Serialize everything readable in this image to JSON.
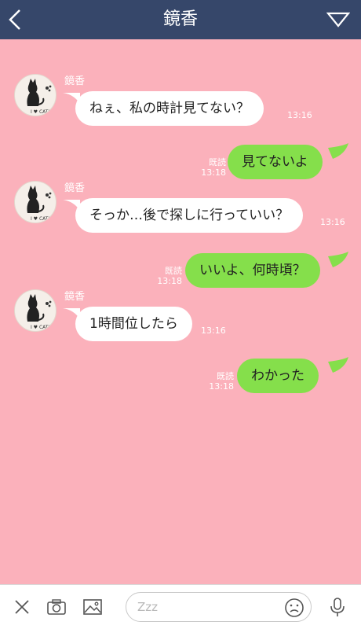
{
  "header": {
    "title": "鏡香"
  },
  "messages": [
    {
      "direction": "in",
      "sender": "鏡香",
      "text": "ねぇ、私の時計見てない？",
      "time": "13:16"
    },
    {
      "direction": "out",
      "text": "見てないよ",
      "read": "既読",
      "time": "13:18"
    },
    {
      "direction": "in",
      "sender": "鏡香",
      "text": "そっか…後で探しに行っていい？",
      "time": "13:16"
    },
    {
      "direction": "out",
      "text": "いいよ、何時頃？",
      "read": "既読",
      "time": "13:18"
    },
    {
      "direction": "in",
      "sender": "鏡香",
      "text": "1時間位したら",
      "time": "13:16"
    },
    {
      "direction": "out",
      "text": "わかった",
      "read": "既読",
      "time": "13:18"
    }
  ],
  "avatar": {
    "caption": "I ♥ CATS"
  },
  "composer": {
    "placeholder": "Zzz"
  },
  "icons": [
    "back-arrow-icon",
    "menu-triangle-icon",
    "close-icon",
    "camera-icon",
    "image-icon",
    "emoji-icon",
    "microphone-icon"
  ],
  "colors": {
    "header": "#36476a",
    "background": "#fbb1bb",
    "incoming": "#ffffff",
    "outgoing": "#85df4b"
  }
}
